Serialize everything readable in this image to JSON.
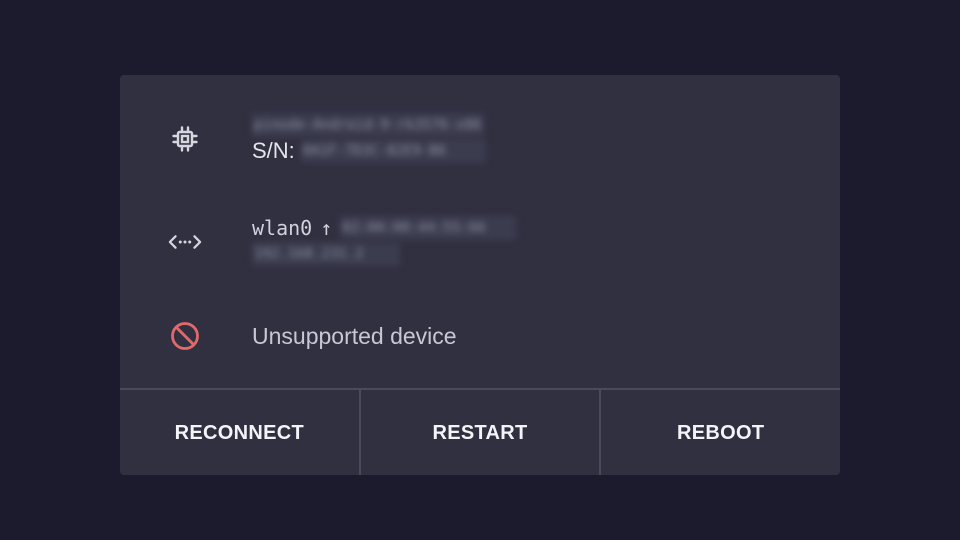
{
  "device": {
    "model": "pinode-Android-9-rk3576-x86",
    "serial_label": "S/N:",
    "serial_value": "0A1F-7D3C-82E9-B6"
  },
  "network": {
    "interface": "wlan0",
    "arrow": "↑",
    "mac": "02:00:00:44:55:66",
    "ip": "192.168.231.2"
  },
  "status": {
    "text": "Unsupported device",
    "color": "#e06a6a"
  },
  "actions": {
    "reconnect": "RECONNECT",
    "restart": "RESTART",
    "reboot": "REBOOT"
  }
}
